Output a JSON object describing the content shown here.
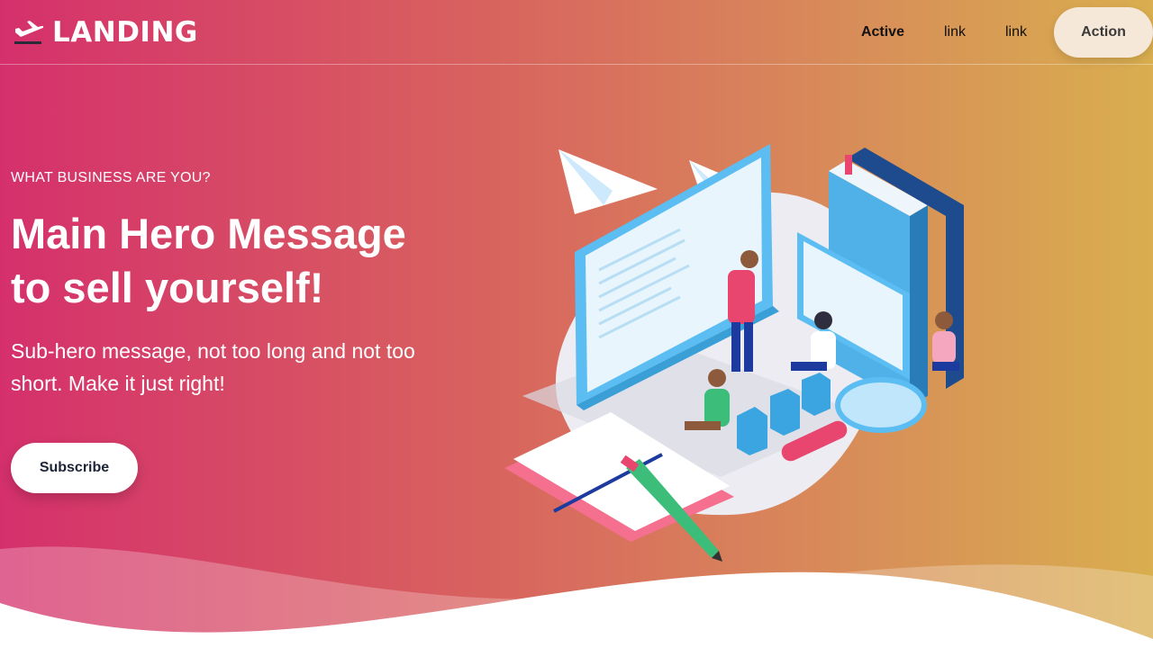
{
  "nav": {
    "brand": "LANDING",
    "brand_icon": "plane-departure-icon",
    "links": [
      {
        "label": "Active",
        "active": true
      },
      {
        "label": "link",
        "active": false
      },
      {
        "label": "link",
        "active": false
      }
    ],
    "action_label": "Action"
  },
  "hero": {
    "eyebrow": "WHAT BUSINESS ARE YOU?",
    "title_line1": "Main Hero Message",
    "title_line2": "to sell yourself!",
    "subtitle": "Sub-hero message, not too long and not too short. Make it just right!",
    "cta_label": "Subscribe"
  },
  "colors": {
    "gradient_start": "#d5306c",
    "gradient_end": "#d9ae4f",
    "button_bg": "#ffffff",
    "action_bg": "#f5e8d8"
  }
}
